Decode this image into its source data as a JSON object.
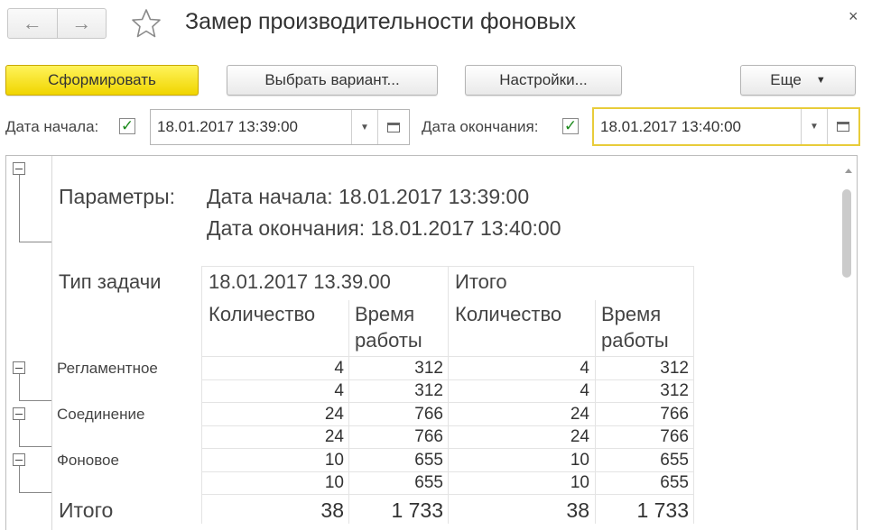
{
  "window": {
    "title": "Замер производительности фоновых",
    "back_icon": "arrow-left-icon",
    "forward_icon": "arrow-right-icon",
    "favorite_icon": "star-icon",
    "close_glyph": "×"
  },
  "toolbar": {
    "generate_label": "Сформировать",
    "select_variant_label": "Выбрать вариант...",
    "settings_label": "Настройки...",
    "more_label": "Еще"
  },
  "period": {
    "start_label": "Дата начала:",
    "start_checked": true,
    "start_value": "18.01.2017 13:39:00",
    "end_label": "Дата окончания:",
    "end_checked": true,
    "end_value": "18.01.2017 13:40:00"
  },
  "report": {
    "params_label": "Параметры:",
    "param_start": "Дата начала: 18.01.2017 13:39:00",
    "param_end": "Дата окончания: 18.01.2017 13:40:00",
    "header": {
      "task_type": "Тип задачи",
      "period_col": "18.01.2017 13.39.00",
      "total_col": "Итого",
      "count_1": "Количество",
      "time_1a": "Время",
      "time_1b": "работы",
      "count_2": "Количество",
      "time_2a": "Время",
      "time_2b": "работы"
    },
    "rows": [
      {
        "label": "Регламентное",
        "c1": "4",
        "t1": "312",
        "c2": "4",
        "t2": "312"
      },
      {
        "label": "",
        "c1": "4",
        "t1": "312",
        "c2": "4",
        "t2": "312"
      },
      {
        "label": "Соединение",
        "c1": "24",
        "t1": "766",
        "c2": "24",
        "t2": "766"
      },
      {
        "label": "",
        "c1": "24",
        "t1": "766",
        "c2": "24",
        "t2": "766"
      },
      {
        "label": "Фоновое",
        "c1": "10",
        "t1": "655",
        "c2": "10",
        "t2": "655"
      },
      {
        "label": "",
        "c1": "10",
        "t1": "655",
        "c2": "10",
        "t2": "655"
      }
    ],
    "total": {
      "label": "Итого",
      "c1": "38",
      "t1": "1 733",
      "c2": "38",
      "t2": "1 733"
    }
  },
  "colors": {
    "primary_button": "#f0d500",
    "focus_border": "#e8cc3a",
    "checkmark": "#1c8a1c"
  }
}
